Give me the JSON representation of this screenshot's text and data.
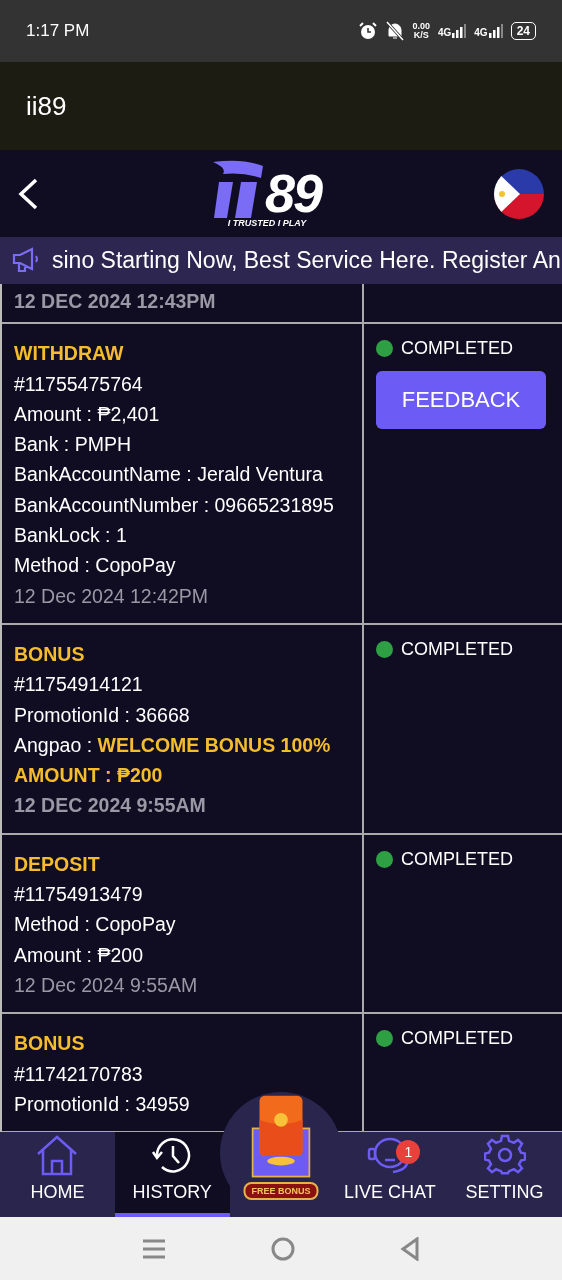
{
  "status_bar": {
    "time": "1:17 PM",
    "net_speed": "0.00",
    "net_unit": "K/S",
    "sim1": "4G",
    "sim2": "4G",
    "battery": "24"
  },
  "app_bar": {
    "title": "ii89"
  },
  "header": {
    "logo_text": "89",
    "tagline": "I TRUSTED I PLAY"
  },
  "marquee": {
    "text": "sino Starting Now, Best Service Here. Register An"
  },
  "transactions": [
    {
      "lines": [
        {
          "kind": "date_bold",
          "text": "12 DEC 2024 12:43PM"
        }
      ]
    },
    {
      "lines": [
        {
          "kind": "type",
          "text": "WITHDRAW"
        },
        {
          "kind": "text",
          "text": "#11755475764"
        },
        {
          "kind": "text",
          "text": "Amount : ₱2,401"
        },
        {
          "kind": "text",
          "text": "Bank : PMPH"
        },
        {
          "kind": "text",
          "text": "BankAccountName : Jerald Ventura"
        },
        {
          "kind": "text",
          "text": "BankAccountNumber : 09665231895"
        },
        {
          "kind": "text",
          "text": "BankLock : 1"
        },
        {
          "kind": "text",
          "text": "Method : CopoPay"
        },
        {
          "kind": "date",
          "text": "12 Dec 2024 12:42PM"
        }
      ],
      "status": "COMPLETED",
      "color": "#2ea043",
      "button": "FEEDBACK"
    },
    {
      "lines": [
        {
          "kind": "type",
          "text": "BONUS"
        },
        {
          "kind": "text",
          "text": "#11754914121"
        },
        {
          "kind": "text",
          "text": "PromotionId : 36668"
        },
        {
          "kind": "text",
          "text": "Angpao : **WELCOME BONUS 100%**"
        },
        {
          "kind": "highlight",
          "text": "AMOUNT : ₱200"
        },
        {
          "kind": "date_bold",
          "text": "12 DEC 2024 9:55AM"
        }
      ],
      "status": "COMPLETED",
      "color": "#2ea043"
    },
    {
      "lines": [
        {
          "kind": "type",
          "text": "DEPOSIT"
        },
        {
          "kind": "text",
          "text": "#11754913479"
        },
        {
          "kind": "text",
          "text": "Method : CopoPay"
        },
        {
          "kind": "text",
          "text": "Amount : ₱200"
        },
        {
          "kind": "date",
          "text": "12 Dec 2024 9:55AM"
        }
      ],
      "status": "COMPLETED",
      "color": "#2ea043"
    },
    {
      "lines": [
        {
          "kind": "type",
          "text": "BONUS"
        },
        {
          "kind": "text",
          "text": "#11742170783"
        },
        {
          "kind": "text",
          "text": "PromotionId : 34959"
        }
      ],
      "status": "COMPLETED",
      "color": "#2ea043"
    }
  ],
  "bottom_nav": [
    {
      "kind": "home",
      "label": "HOME",
      "selected": false
    },
    {
      "kind": "history",
      "label": "HISTORY",
      "selected": true
    },
    {
      "kind": "bonus",
      "label": "FREE BONUS",
      "selected": false
    },
    {
      "kind": "chat",
      "label": "LIVE CHAT",
      "selected": false,
      "badge": "1"
    },
    {
      "kind": "setting",
      "label": "SETTING",
      "selected": false
    }
  ]
}
